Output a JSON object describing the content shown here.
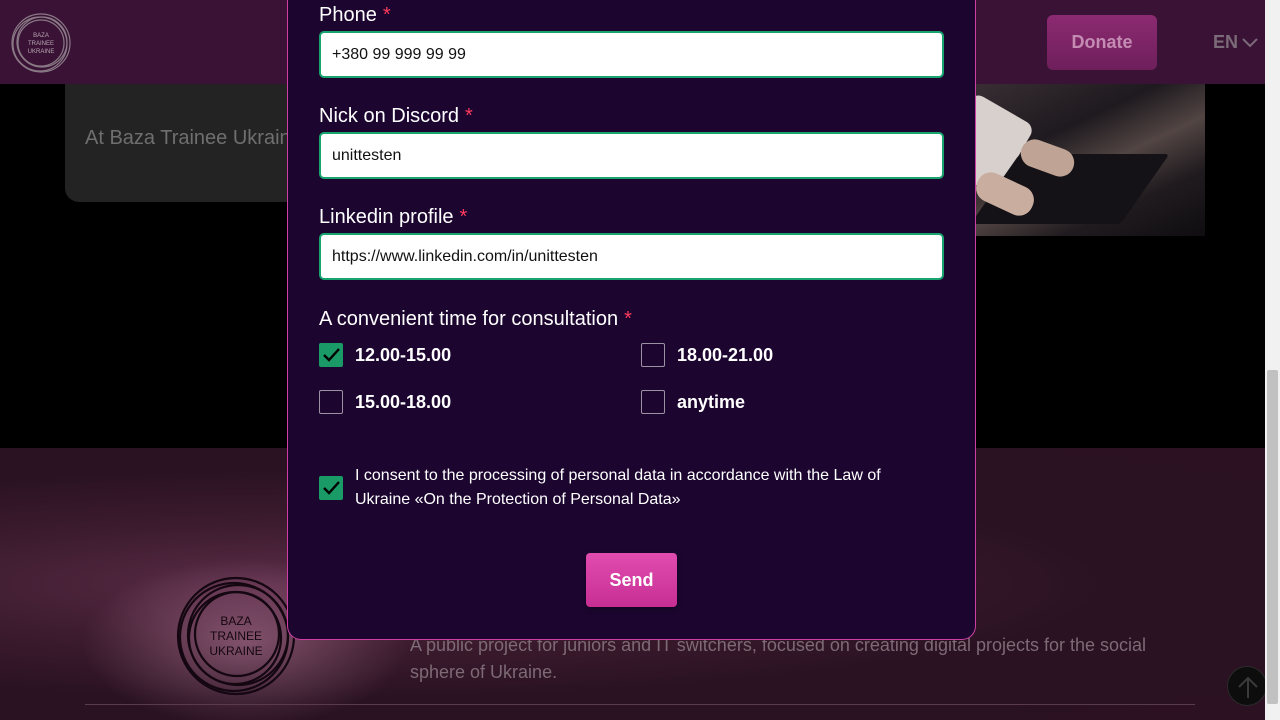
{
  "header": {
    "logo_text": [
      "BAZA",
      "TRAINEE",
      "UKRAINE"
    ],
    "donate_label": "Donate",
    "language": "EN",
    "language_icon": "chevron-down-icon"
  },
  "background": {
    "card_text": "At Baza Trainee Ukraine people at once, contrib"
  },
  "footer": {
    "logo_text": [
      "BAZA",
      "TRAINEE",
      "UKRAINE"
    ],
    "description": "A public project for juniors and IT switchers, focused on creating digital projects for the social sphere of Ukraine."
  },
  "form": {
    "phone": {
      "label": "Phone",
      "required_mark": "*",
      "value": "+380 99 999 99 99"
    },
    "discord": {
      "label": "Nick on Discord",
      "required_mark": "*",
      "value": "unittesten"
    },
    "linkedin": {
      "label": "Linkedin profile",
      "required_mark": "*",
      "value": "https://www.linkedin.com/in/unittesten"
    },
    "time": {
      "label": "A convenient time for consultation",
      "required_mark": "*",
      "options": [
        {
          "label": "12.00-15.00",
          "checked": true
        },
        {
          "label": "18.00-21.00",
          "checked": false
        },
        {
          "label": "15.00-18.00",
          "checked": false
        },
        {
          "label": "anytime",
          "checked": false
        }
      ]
    },
    "consent": {
      "text": "I consent to the processing of personal data in accordance with the Law of Ukraine «On the Protection of Personal Data»",
      "checked": true
    },
    "send_label": "Send"
  },
  "colors": {
    "accent_green": "#1a9a66",
    "send_pink": "#d43c9f",
    "modal_bg": "#1c0630",
    "required_red": "#ff3a5d"
  }
}
